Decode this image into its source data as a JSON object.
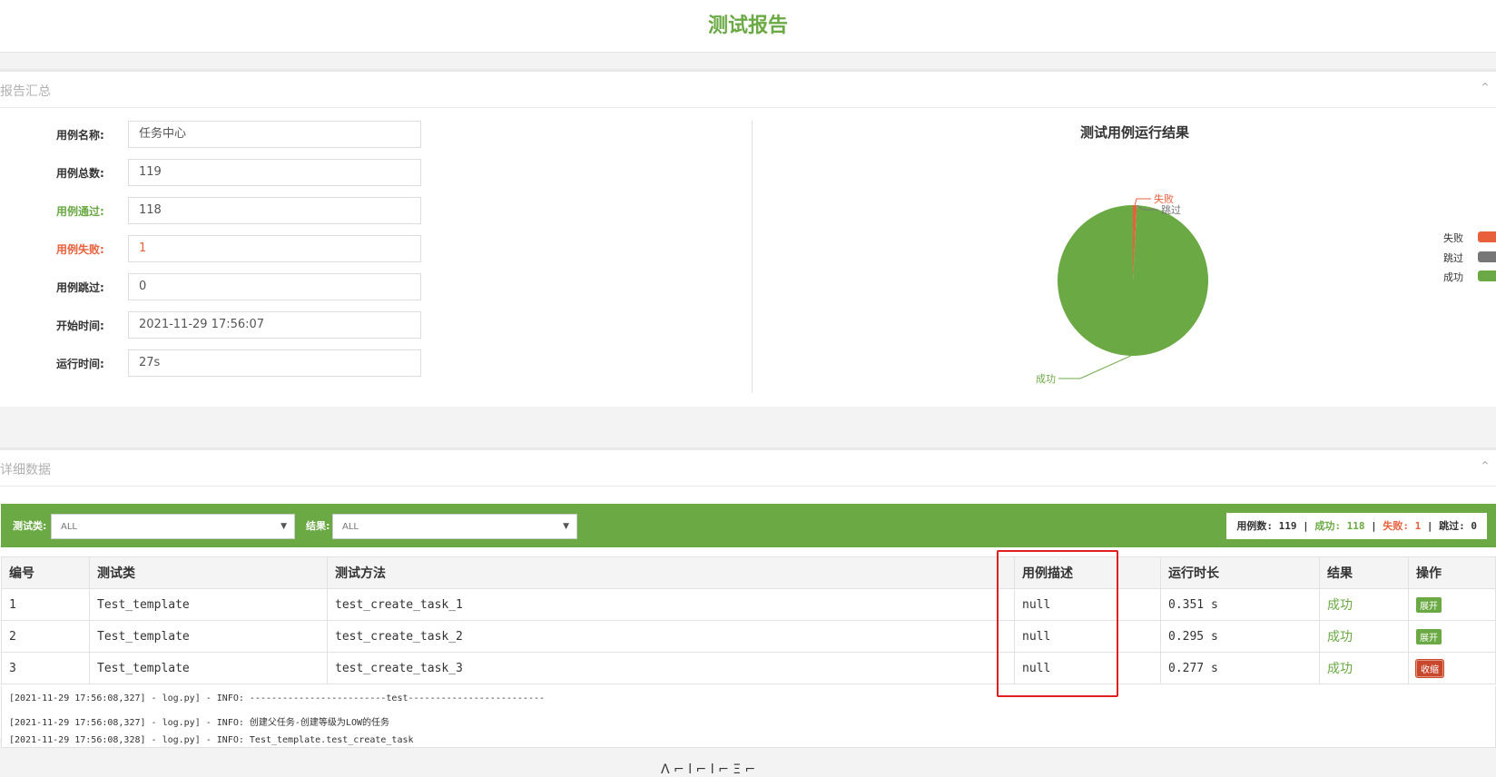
{
  "page": {
    "title": "测试报告"
  },
  "summary": {
    "heading": "报告汇总",
    "fields": [
      {
        "label": "用例名称:",
        "value": "任务中心"
      },
      {
        "label": "用例总数:",
        "value": "119"
      },
      {
        "label": "用例通过:",
        "value": "118"
      },
      {
        "label": "用例失败:",
        "value": "1"
      },
      {
        "label": "用例跳过:",
        "value": "0"
      },
      {
        "label": "开始时间:",
        "value": "2021-11-29 17:56:07"
      },
      {
        "label": "运行时间:",
        "value": "27s"
      }
    ],
    "colors": {
      "pass": "#6aa944",
      "fail": "#e8603c",
      "skip": "#777777"
    }
  },
  "chart_data": {
    "type": "pie",
    "title": "测试用例运行结果",
    "categories": [
      "失败",
      "跳过",
      "成功"
    ],
    "values": [
      1,
      0,
      118
    ],
    "colors": [
      "#e8603c",
      "#777777",
      "#6aa944"
    ],
    "legend": [
      "失败",
      "跳过",
      "成功"
    ],
    "legend_position": "right"
  },
  "detail": {
    "heading": "详细数据",
    "filter": {
      "class_label": "测试类:",
      "class_value": "ALL",
      "result_label": "结果:",
      "result_value": "ALL"
    },
    "stats": {
      "total_label": "用例数:",
      "total": "119",
      "pass_label": "成功:",
      "pass": "118",
      "fail_label": "失败:",
      "fail": "1",
      "skip_label": "跳过:",
      "skip": "0",
      "sep": "|"
    },
    "columns": [
      "编号",
      "测试类",
      "测试方法",
      "用例描述",
      "运行时长",
      "结果",
      "操作"
    ],
    "rows": [
      {
        "no": "1",
        "cls": "Test_template",
        "method": "test_create_task_1",
        "desc": "null",
        "duration": "0.351 s",
        "result": "成功",
        "op": "展开"
      },
      {
        "no": "2",
        "cls": "Test_template",
        "method": "test_create_task_2",
        "desc": "null",
        "duration": "0.295 s",
        "result": "成功",
        "op": "展开"
      },
      {
        "no": "3",
        "cls": "Test_template",
        "method": "test_create_task_3",
        "desc": "null",
        "duration": "0.277 s",
        "result": "成功",
        "op": "收缩"
      }
    ],
    "logs": [
      "[2021-11-29 17:56:08,327] - log.py] - INFO: -------------------------test-------------------------",
      "[2021-11-29 17:56:08,327] - log.py] - INFO: 创建父任务-创建等级为LOW的任务",
      "[2021-11-29 17:56:08,328] - log.py] - INFO: Test_template.test_create_task"
    ]
  },
  "footer": {
    "text": "Λ  ⌐  l  ⌐  l  ⌐  Ξ  ⌐"
  }
}
